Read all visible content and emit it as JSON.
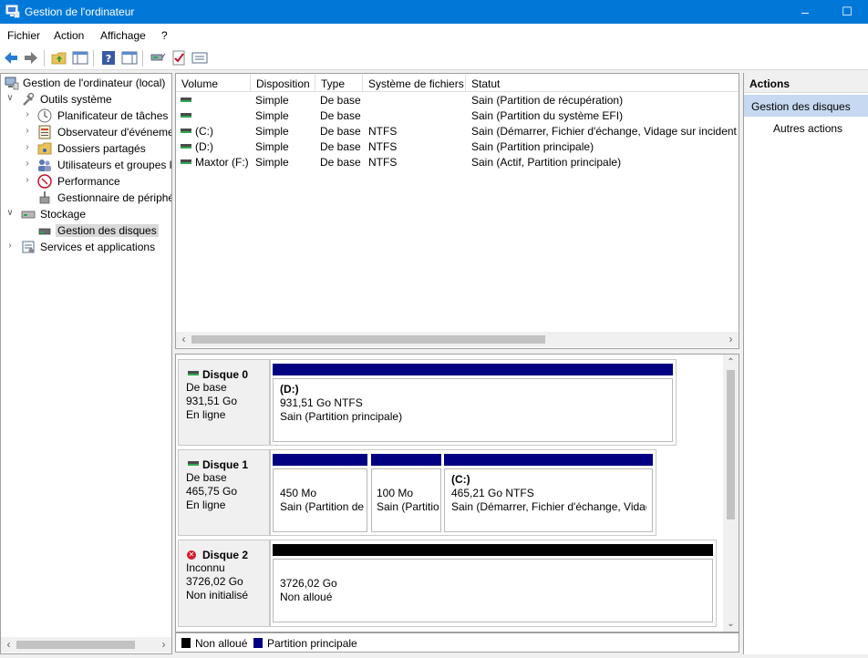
{
  "window": {
    "title": "Gestion de l'ordinateur",
    "app_icon": "computer-management-icon",
    "minimize_symbol": "–",
    "maximize_symbol": "☐"
  },
  "menu": [
    "Fichier",
    "Action",
    "Affichage",
    "?"
  ],
  "toolbar": {
    "icons": [
      "back-arrow-icon",
      "forward-arrow-icon",
      "up-folder-icon",
      "show-hide-tree-icon",
      "help-icon",
      "properties-icon",
      "connect-icon",
      "check-icon",
      "settings-icon"
    ]
  },
  "tree": {
    "root": "Gestion de l'ordinateur (local)",
    "system_tools": "Outils système",
    "task_scheduler": "Planificateur de tâches",
    "event_viewer": "Observateur d'événements",
    "shared_folders": "Dossiers partagés",
    "users_groups": "Utilisateurs et groupes locaux",
    "performance": "Performance",
    "device_manager": "Gestionnaire de périphériques",
    "storage": "Stockage",
    "disk_management": "Gestion des disques",
    "services_apps": "Services et applications"
  },
  "volume_list": {
    "columns": [
      "Volume",
      "Disposition",
      "Type",
      "Système de fichiers",
      "Statut"
    ],
    "rows": [
      [
        "",
        "Simple",
        "De base",
        "",
        "Sain (Partition de récupération)"
      ],
      [
        "",
        "Simple",
        "De base",
        "",
        "Sain (Partition du système EFI)"
      ],
      [
        "(C:)",
        "Simple",
        "De base",
        "NTFS",
        "Sain (Démarrer, Fichier d'échange, Vidage sur incident, Partition principale)"
      ],
      [
        "(D:)",
        "Simple",
        "De base",
        "NTFS",
        "Sain (Partition principale)"
      ],
      [
        "Maxtor (F:)",
        "Simple",
        "De base",
        "NTFS",
        "Sain (Actif, Partition principale)"
      ]
    ]
  },
  "disks": [
    {
      "name": "Disque 0",
      "type": "De base",
      "size": "931,51 Go",
      "state": "En ligne",
      "partitions": [
        {
          "label": "(D:)",
          "size": "931,51 Go NTFS",
          "status": "Sain (Partition principale)"
        }
      ]
    },
    {
      "name": "Disque 1",
      "type": "De base",
      "size": "465,75 Go",
      "state": "En ligne",
      "partitions": [
        {
          "label": "",
          "size": "450 Mo",
          "status": "Sain (Partition de récupération)"
        },
        {
          "label": "",
          "size": "100 Mo",
          "status": "Sain (Partition du système EFI)"
        },
        {
          "label": "(C:)",
          "size": "465,21 Go NTFS",
          "status": "Sain (Démarrer, Fichier d'échange, Vidage sur incident, Partition principale)"
        }
      ]
    },
    {
      "name": "Disque 2",
      "type": "Inconnu",
      "size": "3726,02 Go",
      "state": "Non initialisé",
      "partitions": [
        {
          "label": "",
          "size": "3726,02 Go",
          "status": "Non alloué"
        }
      ]
    }
  ],
  "legend": [
    {
      "label": "Non alloué",
      "color": "#000000"
    },
    {
      "label": "Partition principale",
      "color": "#000080"
    }
  ],
  "actions": {
    "header": "Actions",
    "selected": "Gestion des disques",
    "more": "Autres actions"
  },
  "colors": {
    "titlebar": "#0078d7",
    "primary_partition": "#000080",
    "unallocated": "#000000",
    "actions_selected": "#c6d9f1"
  }
}
